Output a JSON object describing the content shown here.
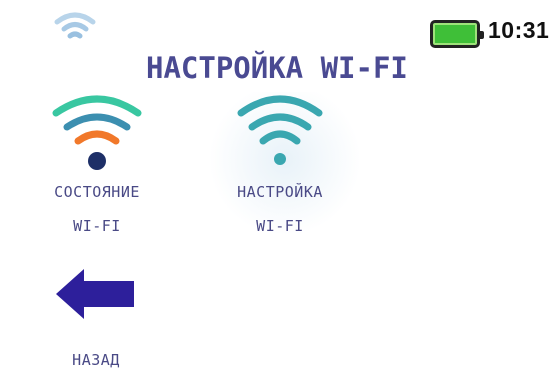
{
  "status_bar": {
    "wifi_icon": "wifi-signal-icon",
    "battery_icon": "battery-full-icon",
    "battery_color": "#3fbf38",
    "time": "10:31"
  },
  "header": {
    "title": "НАСТРОЙКА WI-FI"
  },
  "menu": {
    "items": [
      {
        "label_line1": "СОСТОЯНИЕ",
        "label_line2": "WI-FI",
        "icon": "wifi-status-icon",
        "colors": [
          "#39c7a1",
          "#f1782a",
          "#1d2f67"
        ]
      },
      {
        "label_line1": "НАСТРОЙКА",
        "label_line2": "WI-FI",
        "icon": "wifi-settings-icon",
        "color": "#3aa7b0"
      },
      {
        "label_line1": "НАЗАД",
        "icon": "back-arrow-icon",
        "color": "#2d1f9b"
      }
    ]
  }
}
